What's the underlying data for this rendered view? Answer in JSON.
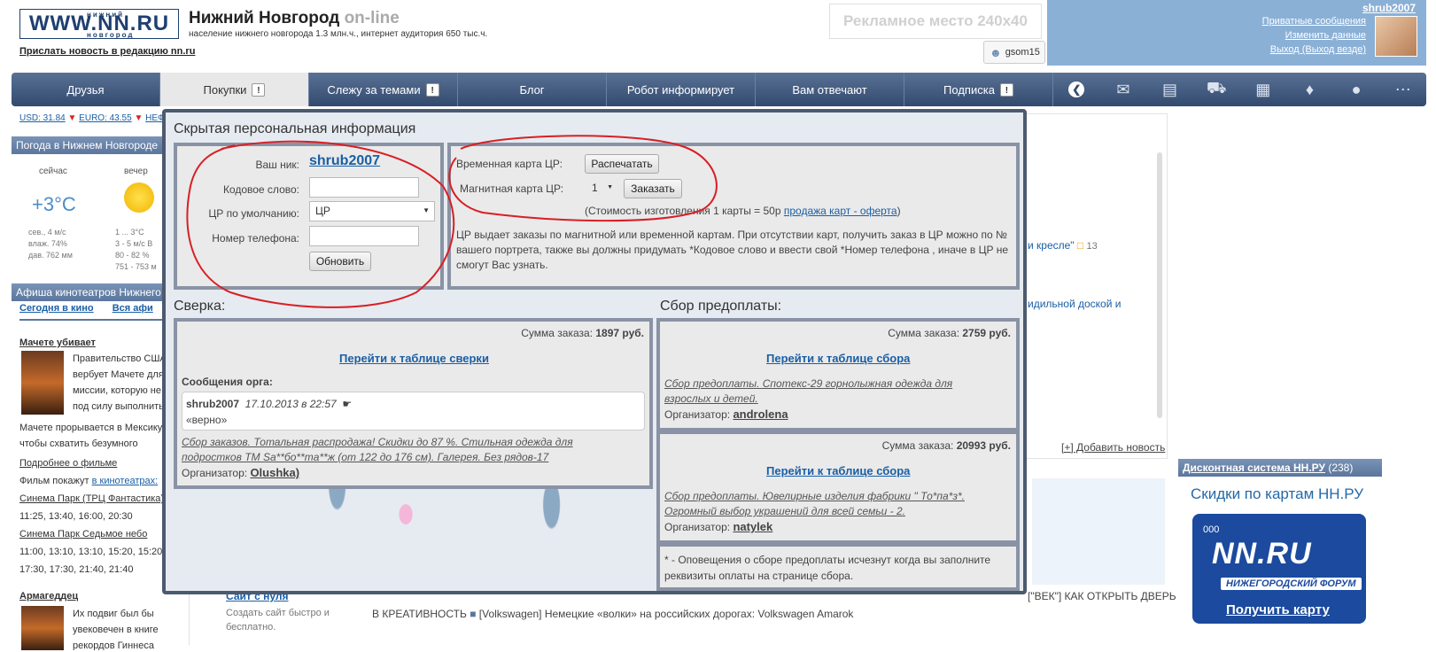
{
  "header": {
    "logo": "WWW.NN.RU",
    "logo_top": "нижний",
    "logo_bottom": "новгород",
    "title": "Нижний Новгород",
    "title_suffix": "on-line",
    "subtitle": "население нижнего новгорода 1.3 млн.ч., интернет аудитория 650 тыс.ч.",
    "send_news": "Прислать новость в редакцию nn.ru",
    "ad": "Рекламное место 240x40",
    "login_name": "gsom15"
  },
  "user": {
    "name": "shrub2007",
    "links": [
      "Приватные сообщения",
      "Изменить данные",
      "Выход (Выход везде)"
    ]
  },
  "nav": {
    "items": [
      {
        "label": "Друзья",
        "badge": ""
      },
      {
        "label": "Покупки",
        "badge": "!"
      },
      {
        "label": "Слежу за темами",
        "badge": "!"
      },
      {
        "label": "Блог",
        "badge": ""
      },
      {
        "label": "Робот информирует",
        "badge": ""
      },
      {
        "label": "Вам отвечают",
        "badge": ""
      },
      {
        "label": "Подписка",
        "badge": "!"
      }
    ],
    "icons": [
      "back-icon",
      "chat-icon",
      "document-icon",
      "car-icon",
      "building-icon",
      "tag-icon",
      "location-icon",
      "more-icon"
    ]
  },
  "left": {
    "usd": "USD: 31.84",
    "euro": "EURO: 43.55",
    "oil": "НЕФ",
    "weather_title": "Погода в Нижнем Новгороде",
    "now_label": "сейчас",
    "evening_label": "вечер",
    "temp": "+3°C",
    "now_stats": [
      "сев., 4 м/с",
      "влаж. 74%",
      "дав. 762 мм"
    ],
    "evening_stats": [
      "1 ... 3°C",
      "3 - 5 м/с В",
      "80 - 82 %",
      "751 - 753 м"
    ],
    "cinema_title": "Афиша кинотеатров Нижнего",
    "tab_today": "Сегодня в кино",
    "tab_all": "Вся афи",
    "movie1_title": "Мачете убивает",
    "movie1_desc": "Правительство США вербует Мачете для миссии, которую не под силу выполнить простому смертном",
    "movie1_desc2": "Мачете прорывается в Мексику чтобы схватить безумного",
    "more_link": "Подробнее о фильме",
    "shown_in": "Фильм покажут",
    "in_cinemas": "в кинотеатрах:",
    "cinema1": "Синема Парк (ТРЦ Фантастика)",
    "cinema1_times": "11:25, 13:40, 16:00, 20:30",
    "cinema2": "Синема Парк Седьмое небо",
    "cinema2_times1": "11:00, 13:10, 13:10, 15:20, 15:20,",
    "cinema2_times2": "17:30, 17:30, 21:40, 21:40",
    "movie2_title": "Армагеддец",
    "movie2_desc": "Их подвиг был бы увековечен в книге рекордов Гиннеса"
  },
  "background": {
    "news1": "и кресле\"",
    "news1_count": "13",
    "news2": "идильной доской и",
    "add_news": "[+] Добавить новость",
    "ticker1": "[\"ВЕК\"] КАК ОТКРЫТЬ ДВЕРЬ",
    "ticker2": "В КРЕАТИВНОСТЬ",
    "ticker3": "[Volkswagen] Немецкие «волки» на российских дорогах: Volkswagen Amarok",
    "promo_link": "Сайт с нуля",
    "promo1": "Создать сайт быстро и",
    "promo2": "бесплатно."
  },
  "right": {
    "discount_title": "Дисконтная система НН.РУ",
    "discount_count": "(238)",
    "discount_heading": "Скидки по картам НН.РУ",
    "card_logo": "NN.RU",
    "card_sub": "НИЖЕГОРОДСКИЙ ФОРУМ",
    "card_chip": "000",
    "card_get": "Получить карту"
  },
  "modal": {
    "hidden_title": "Скрытая персональная информация",
    "nick_label": "Ваш ник:",
    "nick": "shrub2007",
    "code_label": "Кодовое слово:",
    "code_value": "",
    "cp_label": "ЦР по умолчанию:",
    "cp_value": "ЦР",
    "phone_label": "Номер телефона:",
    "phone_value": "",
    "update_btn": "Обновить",
    "temp_card_label": "Временная карта ЦР:",
    "print_btn": "Распечатать",
    "mag_card_label": "Магнитная карта ЦР:",
    "qty": "1",
    "order_btn": "Заказать",
    "cost_note": "(Стоимость изготовления 1 карты = 50р",
    "cost_link": "продажа карт - оферта",
    "cost_close": ")",
    "info": "ЦР выдает заказы по магнитной или временной картам. При отсутствии карт, получить заказ в ЦР можно по № вашего портрета, также вы должны придумать *Кодовое слово и ввести свой *Номер телефона , иначе в ЦР не смогут Вас узнать.",
    "sverka_title": "Сверка:",
    "sverka_sum_label": "Сумма заказа:",
    "sverka_sum": "1897 руб.",
    "sverka_link": "Перейти к таблице сверки",
    "org_msgs": "Сообщения орга:",
    "msg_user": "shrub2007",
    "msg_date": "17.10.2013 в 22:57",
    "msg_text": "«верно»",
    "sverka_purchase": "Сбор заказов. Тотальная распродажа! Скидки до 87 %. Стильная одежда для подростков ТМ Sa**бо**ma**ж (от 122 до 176 см). Галерея. Без рядов-17",
    "org_label": "Организатор:",
    "sverka_org": "Olushka)",
    "prepay_title": "Сбор предоплаты:",
    "prepay1_sum": "2759 руб.",
    "prepay_link": "Перейти к таблице сбора",
    "prepay1_purchase": "Сбор предоплаты. Спотекс-29 горнолыжная одежда для взрослых и детей.",
    "prepay1_org": "androlena",
    "prepay2_sum": "20993 руб.",
    "prepay2_purchase": "Сбор предоплаты. Ювелирные изделия фабрики \" То*па*з*. Огромный выбор украшений для всей семьи - 2.",
    "prepay2_org": "natylek",
    "footnote": "* - Оповещения о сборе предоплаты исчезнут когда вы заполните реквизиты оплаты на странице сбора."
  },
  "colors": {
    "nav": "#334a70",
    "accent": "#1a5fa5",
    "annotation": "#d81f26"
  }
}
